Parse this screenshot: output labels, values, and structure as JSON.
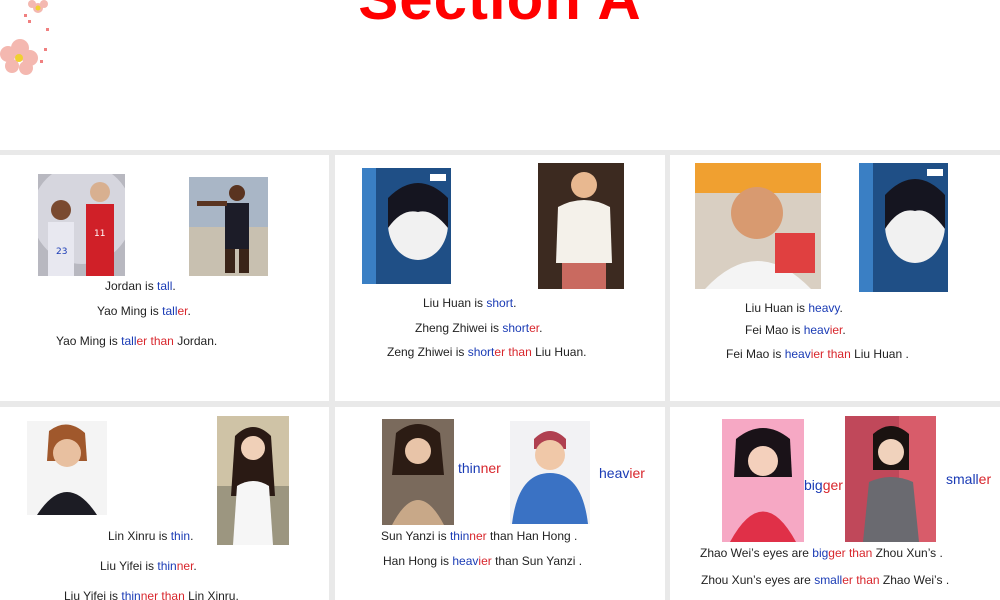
{
  "title": "Section A",
  "colors": {
    "accent_blue": "#1a3bb5",
    "accent_red": "#d8262c",
    "title_red": "#ff0000"
  },
  "panels": {
    "p1": {
      "s1": {
        "a": "Jordan is ",
        "b": "tall",
        "c": "."
      },
      "s2": {
        "a": "Yao Ming  is  ",
        "b": "tall",
        "r": "er",
        "c": "."
      },
      "s3": {
        "a": "Yao Ming  is  ",
        "b": "tall",
        "r": "er",
        "r2": "  than  ",
        "c": "Jordan."
      }
    },
    "p2": {
      "s1": {
        "a": "Liu  Huan  is ",
        "b": "short",
        "c": "."
      },
      "s2": {
        "a": "Zheng  Zhiwei is ",
        "b": "short",
        "r": "er",
        "c": "."
      },
      "s3": {
        "a": "Zeng Zhiwei  is ",
        "b": "short",
        "r": "er than",
        "c": " Liu  Huan."
      }
    },
    "p3": {
      "s1": {
        "a": "Liu  Huan is ",
        "b": "heavy",
        "c": "."
      },
      "s2": {
        "a": "Fei Mao is ",
        "b": "heav",
        "r": "ier",
        "c": "."
      },
      "s3": {
        "a": "Fei Mao  is ",
        "b": "heav",
        "r": "ier than",
        "c": " Liu  Huan ."
      }
    },
    "p4": {
      "s1": {
        "a": "Lin Xinru is ",
        "b": "thin",
        "c": "."
      },
      "s2": {
        "a": "Liu  Yifei  is ",
        "b": "thin",
        "r": "ner",
        "c": "."
      },
      "s3": {
        "a": "Liu Yifei is ",
        "b": "thin",
        "r": "ner than",
        "c": " Lin Xinru."
      }
    },
    "p5": {
      "label_left": {
        "b": "thin",
        "r": "ner"
      },
      "label_right": {
        "b": "heav",
        "r": "ier"
      },
      "s1": {
        "a": "Sun Yanzi  is  ",
        "b": "thin",
        "r": "ner",
        "c": "  than  Han Hong ."
      },
      "s2": {
        "a": "Han  Hong  is  ",
        "b": "heav",
        "r": "ier",
        "c": " than  Sun  Yanzi ."
      }
    },
    "p6": {
      "label_left": {
        "b": "big",
        "r": "ger"
      },
      "label_right": {
        "b": "small",
        "r": "er"
      },
      "s1": {
        "a": "Zhao  Wei’s eyes are ",
        "b": "big",
        "r": "ger than",
        "c": "  Zhou  Xun’s ."
      },
      "s2": {
        "a": "Zhou  Xun’s eyes are ",
        "b": "small",
        "r": "er than",
        "c": " Zhao  Wei’s ."
      }
    }
  }
}
